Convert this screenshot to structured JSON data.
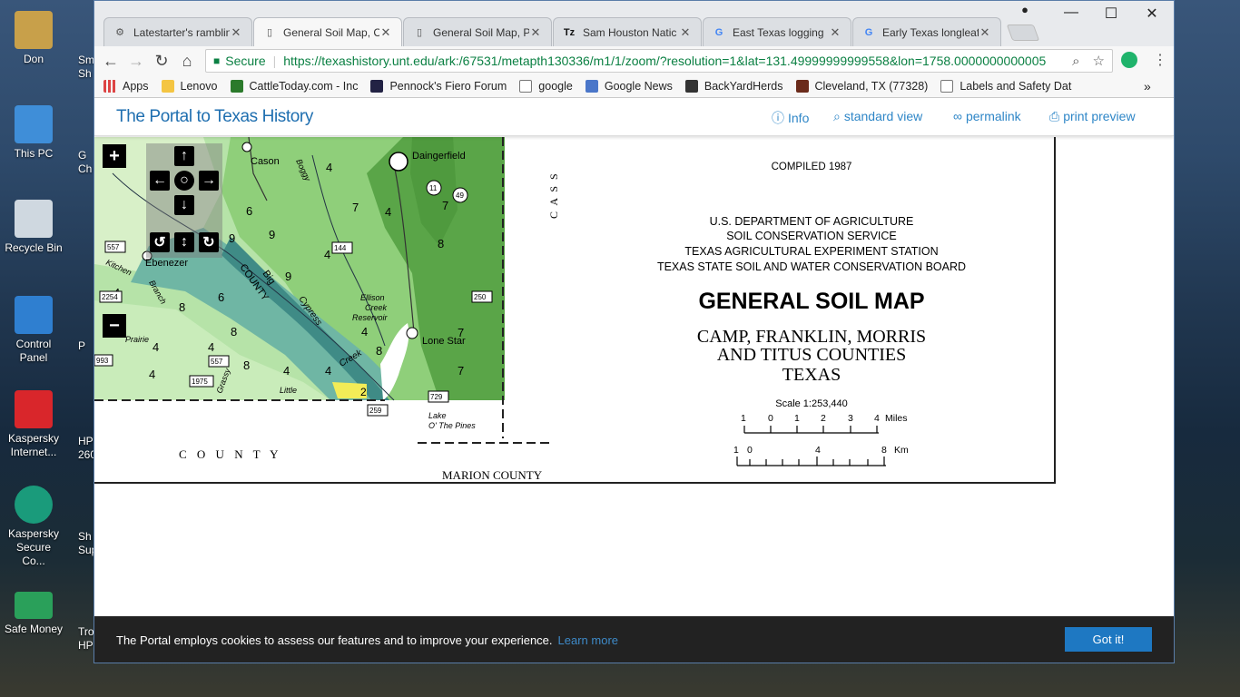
{
  "desktop": {
    "icons": [
      {
        "label": "Don",
        "color": "#c8a04a"
      },
      {
        "label": "This PC",
        "color": "#3f8ed8"
      },
      {
        "label": "Recycle Bin",
        "color": "#cfd8e0"
      },
      {
        "label": "Control Panel",
        "color": "#2f7fd0"
      },
      {
        "label": "Kaspersky Internet...",
        "color": "#d9262b"
      },
      {
        "label": "Kaspersky Secure Co...",
        "color": "#1a9b7b"
      },
      {
        "label": "Safe Money",
        "color": "#2aa05a"
      }
    ],
    "peeks": [
      "Smar",
      "Sh",
      "G",
      "Ch",
      "P",
      "HP",
      "260",
      "Sh",
      "Supp",
      "Troul",
      "HP In"
    ]
  },
  "browser": {
    "tabs": [
      {
        "title": "Latestarter's ramblin",
        "icon": "gear-face"
      },
      {
        "title": "General Soil Map, C",
        "icon": "page"
      },
      {
        "title": "General Soil Map, P",
        "icon": "page"
      },
      {
        "title": "Sam Houston Natic",
        "icon": "tz"
      },
      {
        "title": "East Texas logging",
        "icon": "google"
      },
      {
        "title": "Early Texas longleaf",
        "icon": "google"
      }
    ],
    "secure_label": "Secure",
    "url_prefix": "https://",
    "url_host": "texashistory.unt.edu",
    "url_path": "/ark:/67531/metapth130336/m1/1/zoom/?resolution=1&lat=131.49999999999558&lon=1758.0000000000005",
    "bookmarks": [
      {
        "label": "Apps",
        "color": "#d44"
      },
      {
        "label": "Lenovo",
        "color": "#f4c542"
      },
      {
        "label": "CattleToday.com - Inc",
        "color": "#2b7a2b"
      },
      {
        "label": "Pennock's Fiero Forum",
        "color": "#224"
      },
      {
        "label": "google",
        "color": "#ffffff"
      },
      {
        "label": "Google News",
        "color": "#4a76c9"
      },
      {
        "label": "BackYardHerds",
        "color": "#333"
      },
      {
        "label": "Cleveland, TX (77328)",
        "color": "#6b2b1b"
      },
      {
        "label": "Labels and Safety Dat",
        "color": "#ffffff"
      }
    ],
    "more": "»"
  },
  "portal": {
    "title": "The Portal to Texas History",
    "links": {
      "info": "Info",
      "standard": "standard view",
      "permalink": "permalink",
      "print": "print preview"
    }
  },
  "map": {
    "compiled": "COMPILED 1987",
    "agency": [
      "U.S. DEPARTMENT OF AGRICULTURE",
      "SOIL CONSERVATION SERVICE",
      "TEXAS AGRICULTURAL EXPERIMENT STATION",
      "TEXAS STATE SOIL AND WATER CONSERVATION BOARD"
    ],
    "title": "GENERAL SOIL MAP",
    "subtitle": [
      "CAMP, FRANKLIN, MORRIS",
      "AND TITUS COUNTIES",
      "TEXAS"
    ],
    "scale": "Scale 1:253,440",
    "miles_ticks": [
      "1",
      "0",
      "1",
      "2",
      "3",
      "4"
    ],
    "miles_label": "Miles",
    "km_ticks": [
      "1",
      "0",
      "4",
      "8"
    ],
    "km_label": "Km",
    "places": {
      "cason": "Cason",
      "daingerfield": "Daingerfield",
      "ebenezer": "Ebenezer",
      "lone_star": "Lone Star",
      "ellison1": "Ellison",
      "ellison2": "Creek",
      "ellison3": "Reservoir",
      "lake1": "Lake",
      "lake2": "O' The Pines",
      "cass": "C A S S",
      "county": "C O U N T Y",
      "marion": "MARION  COUNTY",
      "big": "Big",
      "county2": "COUNTY",
      "cypress": "Cypress",
      "creek": "Creek",
      "kitchen": "Kitchen",
      "prairie": "Prairie",
      "little": "Little",
      "grassy": "Grassy",
      "branch": "Branch",
      "boggy": "Boggy"
    },
    "unit_numbers": [
      "4",
      "7",
      "4",
      "7",
      "6",
      "9",
      "9",
      "8",
      "4",
      "9",
      "6",
      "7",
      "4",
      "8",
      "8",
      "4",
      "4",
      "4",
      "4",
      "4",
      "8",
      "7",
      "4",
      "2",
      "4",
      "8"
    ],
    "highways": [
      "557",
      "2254",
      "144",
      "250",
      "993",
      "557",
      "1975",
      "259",
      "729",
      "11",
      "49"
    ]
  },
  "cookie": {
    "text": "The Portal employs cookies to assess our features and to improve your experience.",
    "learn_more": "Learn more",
    "button": "Got it!"
  }
}
